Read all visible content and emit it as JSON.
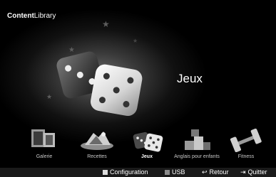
{
  "header": {
    "title_bold": "Content",
    "title_normal": "Library"
  },
  "hero": {
    "label": "Jeux",
    "icon": "dice-icon"
  },
  "categories": [
    {
      "label": "Galerie",
      "icon": "gallery-icon"
    },
    {
      "label": "Recettes",
      "icon": "recipes-icon"
    },
    {
      "label": "Jeux",
      "icon": "dice-icon",
      "selected": true
    },
    {
      "label": "Anglais pour enfants",
      "icon": "english-for-kids-icon"
    },
    {
      "label": "Fitness",
      "icon": "dumbbell-icon"
    }
  ],
  "bottom_bar": {
    "configuration": "Configuration",
    "usb": "USB",
    "retour": "Retour",
    "quitter": "Quitter",
    "configuration_color": "#dcdcdc",
    "usb_color": "#8c8c8c"
  }
}
